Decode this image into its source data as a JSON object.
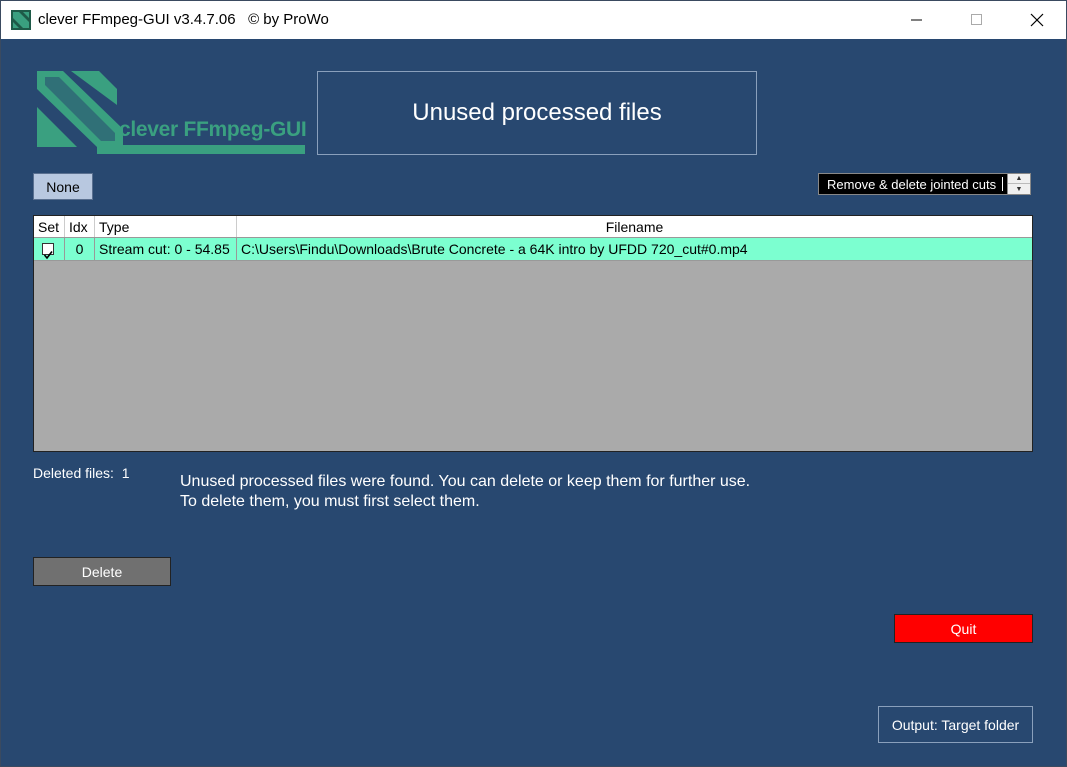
{
  "window": {
    "title": "clever FFmpeg-GUI v3.4.7.06   © by ProWo"
  },
  "logo": {
    "text": "clever FFmpeg-GUI"
  },
  "header": {
    "title": "Unused processed files"
  },
  "toolbar": {
    "none_label": "None",
    "mode_value": "Remove & delete jointed cuts"
  },
  "table": {
    "columns": [
      "Set",
      "Idx",
      "Type",
      "Filename"
    ],
    "rows": [
      {
        "set": true,
        "idx": "0",
        "type": "Stream cut: 0 - 54.85",
        "filename": "C:\\Users\\Findu\\Downloads\\Brute Concrete - a 64K intro by UFDD 720_cut#0.mp4"
      }
    ]
  },
  "status": {
    "deleted_label": "Deleted files:",
    "deleted_count": "1",
    "message_line1": "Unused processed files were found. You can delete or keep them for further use.",
    "message_line2": "To delete them, you must first select them."
  },
  "actions": {
    "delete_label": "Delete",
    "quit_label": "Quit",
    "output_label": "Output: Target folder"
  },
  "colors": {
    "background": "#284870",
    "row_highlight": "#7cffd0",
    "quit": "#ff0000",
    "logo": "#3aa080"
  }
}
